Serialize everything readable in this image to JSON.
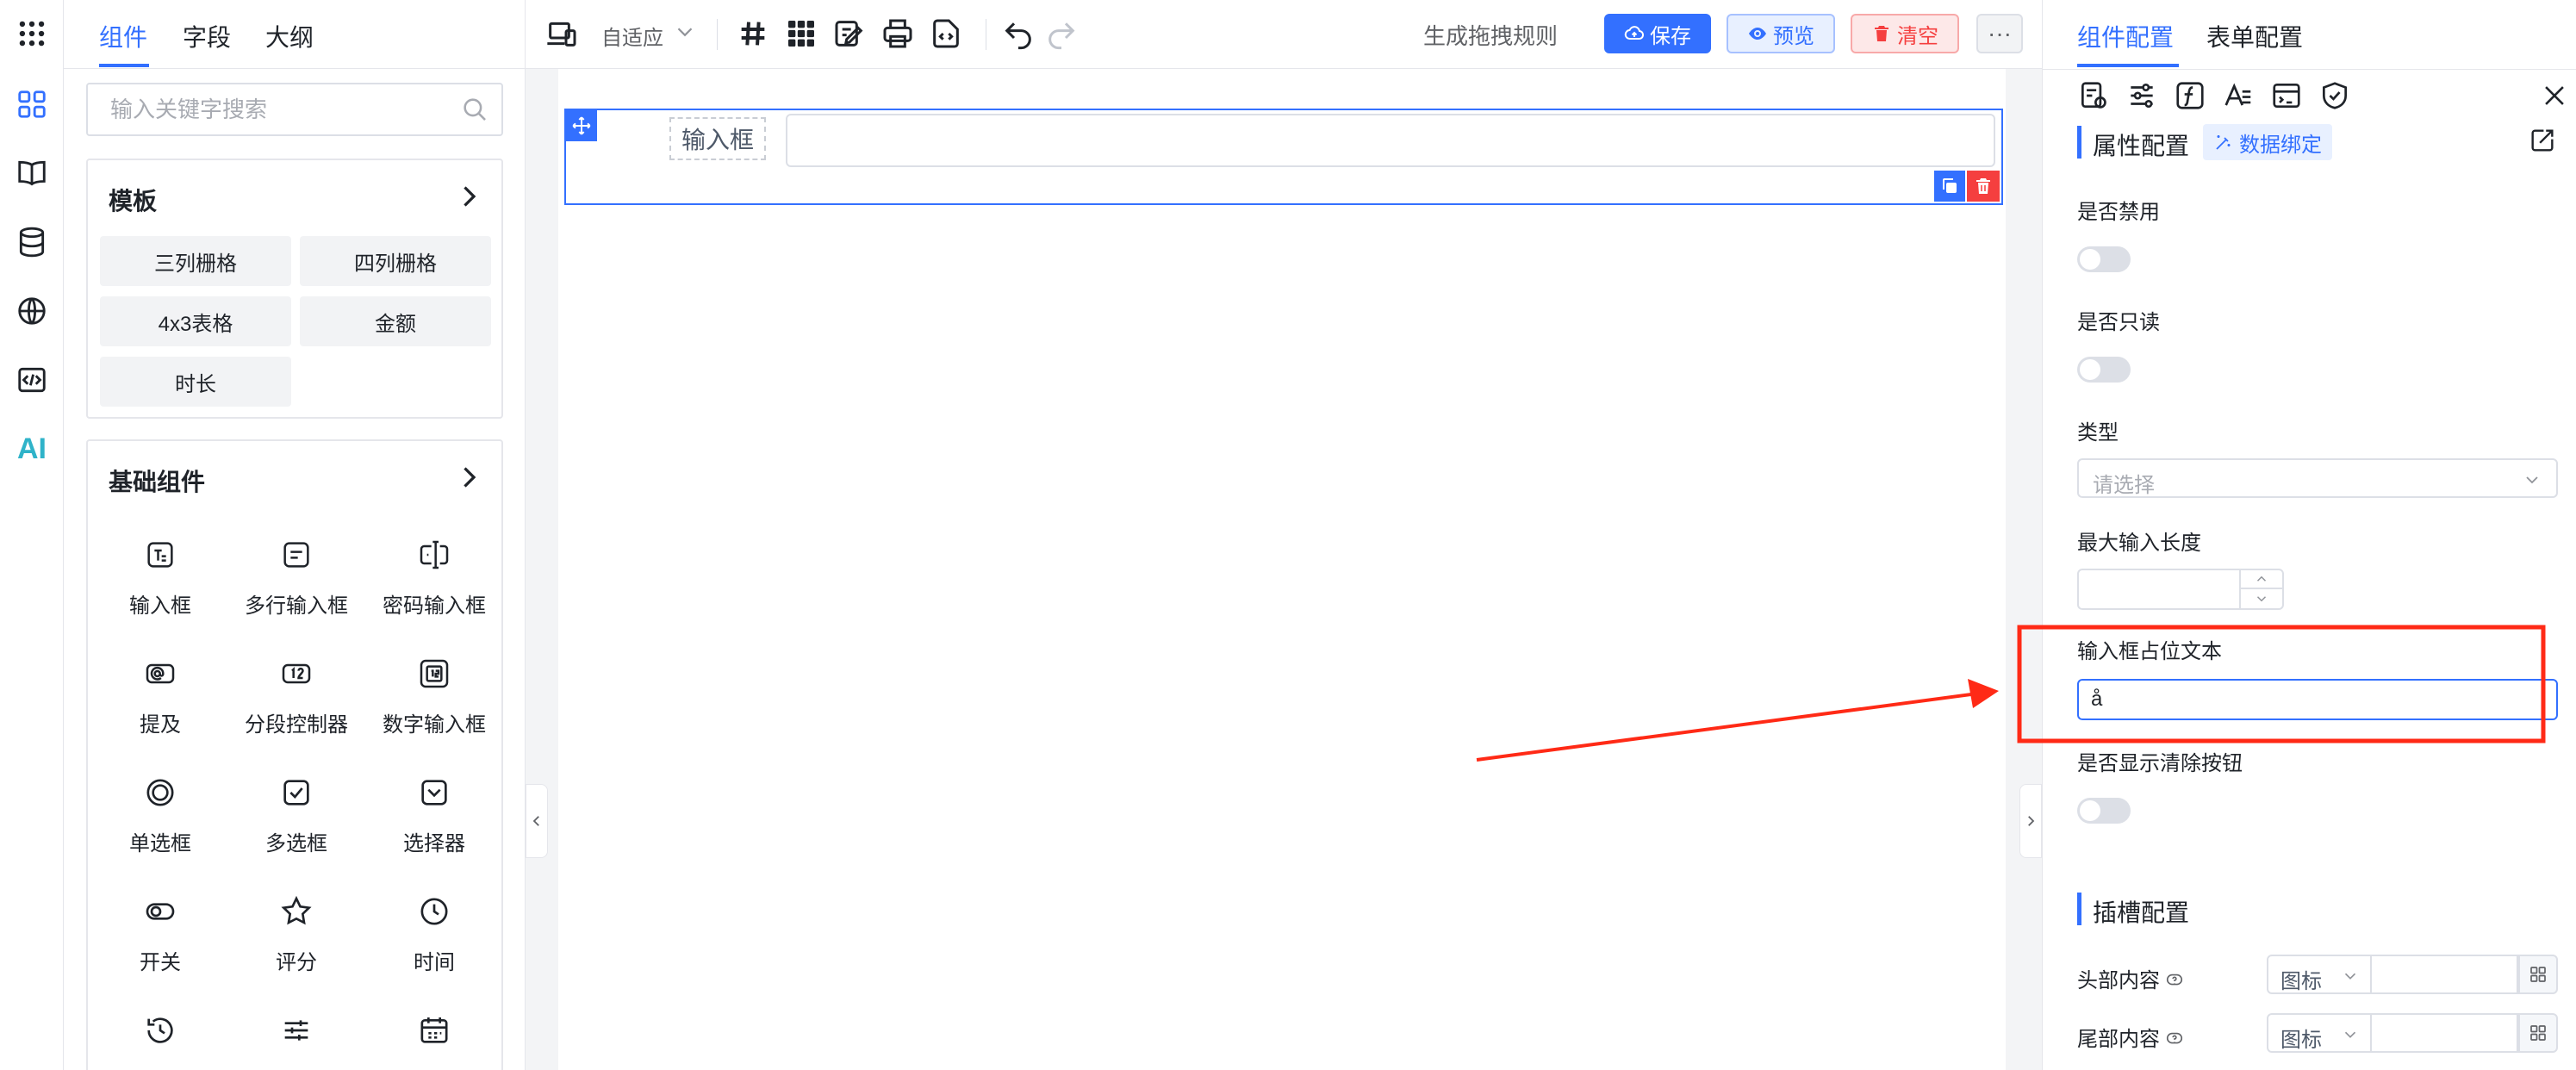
{
  "sidebar_tabs": [
    "组件",
    "字段",
    "大纲"
  ],
  "search_placeholder": "输入关键字搜索",
  "template_group": {
    "title": "模板",
    "items": [
      "三列栅格",
      "四列栅格",
      "4x3表格",
      "金额",
      "时长"
    ]
  },
  "basic_group": {
    "title": "基础组件",
    "items": [
      {
        "label": "输入框",
        "icon": "text-input-icon"
      },
      {
        "label": "多行输入框",
        "icon": "textarea-icon"
      },
      {
        "label": "密码输入框",
        "icon": "password-icon"
      },
      {
        "label": "提及",
        "icon": "mention-icon"
      },
      {
        "label": "分段控制器",
        "icon": "segmented-icon"
      },
      {
        "label": "数字输入框",
        "icon": "number-input-icon"
      },
      {
        "label": "单选框",
        "icon": "radio-icon"
      },
      {
        "label": "多选框",
        "icon": "checkbox-icon"
      },
      {
        "label": "选择器",
        "icon": "select-icon"
      },
      {
        "label": "开关",
        "icon": "switch-icon"
      },
      {
        "label": "评分",
        "icon": "star-icon"
      },
      {
        "label": "时间",
        "icon": "clock-icon"
      }
    ]
  },
  "rail_ai_label": "AI",
  "toolbar": {
    "adaptive": "自适应",
    "rules": "生成拖拽规则",
    "save": "保存",
    "preview": "预览",
    "clear": "清空",
    "more": "···"
  },
  "canvas": {
    "field_label": "输入框"
  },
  "config": {
    "tabs": [
      "组件配置",
      "表单配置"
    ],
    "attr_section": "属性配置",
    "data_binding": "数据绑定",
    "fields": {
      "disabled": "是否禁用",
      "readonly": "是否只读",
      "type": "类型",
      "type_placeholder": "请选择",
      "maxlength": "最大输入长度",
      "placeholder_label": "输入框占位文本",
      "placeholder_value": "å",
      "clearable": "是否显示清除按钮"
    },
    "slot_section": "插槽配置",
    "slots": [
      {
        "label": "头部内容",
        "select": "图标"
      },
      {
        "label": "尾部内容",
        "select": "图标"
      }
    ]
  },
  "colors": {
    "primary": "#3370ff",
    "danger": "#f53f3f",
    "annotation": "#ff2a16"
  }
}
